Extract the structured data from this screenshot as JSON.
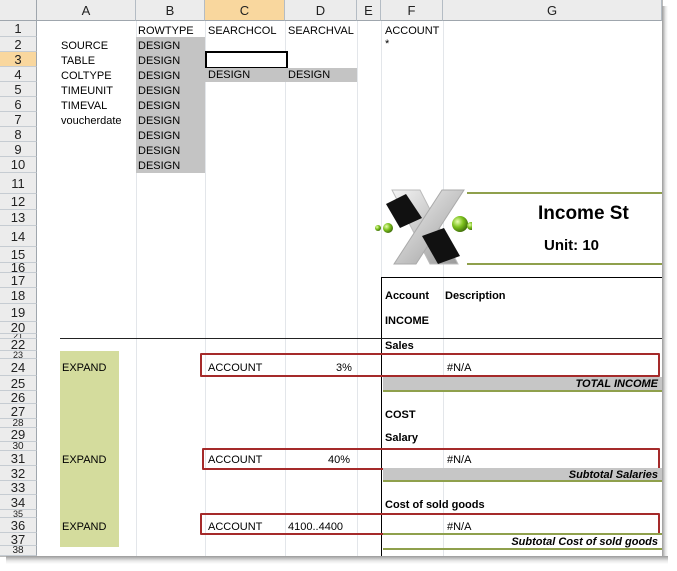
{
  "columns": [
    "A",
    "B",
    "C",
    "D",
    "E",
    "F",
    "G"
  ],
  "rows": [
    "1",
    "2",
    "3",
    "4",
    "5",
    "6",
    "7",
    "8",
    "9",
    "10",
    "11",
    "12",
    "13",
    "14",
    "15",
    "16",
    "17",
    "18",
    "19",
    "20",
    "21",
    "22",
    "23",
    "24",
    "25",
    "26",
    "27",
    "28",
    "29",
    "30",
    "31",
    "32",
    "33",
    "34",
    "35",
    "36",
    "37",
    "38"
  ],
  "selected_column": "C",
  "selected_row": "3",
  "header_row": {
    "b1": "ROWTYPE",
    "c1": "SEARCHCOL",
    "d1": "SEARCHVAL",
    "f1": "ACCOUNT",
    "f2": "*"
  },
  "a_labels": [
    "SOURCE",
    "TABLE",
    "COLTYPE",
    "TIMEUNIT",
    "TIMEVAL",
    "voucherdate"
  ],
  "design_label": "DESIGN",
  "design_b": [
    "DESIGN",
    "DESIGN",
    "DESIGN",
    "DESIGN",
    "DESIGN",
    "DESIGN",
    "DESIGN",
    "DESIGN",
    "DESIGN"
  ],
  "c4": "DESIGN",
  "d4": "DESIGN",
  "report": {
    "title": "Income St",
    "unit": "Unit: 10",
    "account_header": "Account",
    "description_header": "Description",
    "income": "INCOME",
    "sales": "Sales",
    "total_income": "TOTAL INCOME",
    "cost": "COST",
    "salary": "Salary",
    "subtotal_salaries": "Subtotal Salaries",
    "cost_of_sold_goods": "Cost of sold goods",
    "subtotal_cost": "Subtotal Cost of sold goods"
  },
  "expand_rows": [
    {
      "a": "EXPAND",
      "c": "ACCOUNT",
      "d": "3%",
      "f": "#N/A"
    },
    {
      "a": "EXPAND",
      "c": "ACCOUNT",
      "d": "40%",
      "f": "#N/A"
    },
    {
      "a": "EXPAND",
      "c": "ACCOUNT",
      "d": "4100..4400",
      "f": "#N/A"
    }
  ],
  "colors": {
    "header_bg": "#ececec",
    "selected_header": "#f9d79e",
    "design_fill": "#c4c4c4",
    "expand_fill": "#d4dc9d",
    "red_outline": "#a52a2a",
    "olive_rule": "#8fa04c"
  }
}
